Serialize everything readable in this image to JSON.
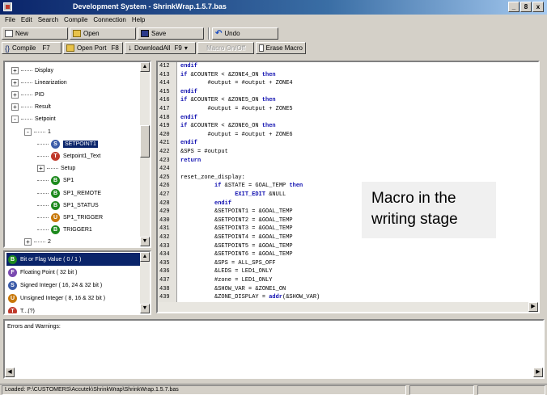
{
  "window": {
    "title": "Development System - ShrinkWrap.1.5.7.bas",
    "controls": [
      "_",
      "8",
      "x"
    ]
  },
  "menu": [
    "File",
    "Edit",
    "Search",
    "Compile",
    "Connection",
    "Help"
  ],
  "toolbar1": {
    "new_label": "New",
    "open_label": "Open",
    "save_label": "Save",
    "undo_label": "Undo"
  },
  "toolbar2": {
    "compile_label": "Compile",
    "compile_key": "F7",
    "open_port_label": "Open Port",
    "open_port_key": "F8",
    "download_label": "DownloadAll",
    "download_key": "F9",
    "macro_label": "Macro On/Off",
    "erase_label": "Erase Macro"
  },
  "tree": {
    "items": [
      {
        "label": "Display",
        "level": 0,
        "expander": "+"
      },
      {
        "label": "Linearization",
        "level": 0,
        "expander": "+"
      },
      {
        "label": "PID",
        "level": 0,
        "expander": "+"
      },
      {
        "label": "Result",
        "level": 0,
        "expander": "+"
      },
      {
        "label": "Setpoint",
        "level": 0,
        "expander": "-"
      },
      {
        "label": "1",
        "level": 1,
        "expander": "-"
      },
      {
        "label": "SETPOINT1",
        "level": 2,
        "icon": "S",
        "color": "blue",
        "selected": true
      },
      {
        "label": "Setpoint1_Text",
        "level": 2,
        "icon": "T",
        "color": "red"
      },
      {
        "label": "Setup",
        "level": 2,
        "expander": "+"
      },
      {
        "label": "SP1",
        "level": 2,
        "icon": "B",
        "color": "green"
      },
      {
        "label": "SP1_REMOTE",
        "level": 2,
        "icon": "B",
        "color": "green"
      },
      {
        "label": "SP1_STATUS",
        "level": 2,
        "icon": "B",
        "color": "green"
      },
      {
        "label": "SP1_TRIGGER",
        "level": 2,
        "icon": "U",
        "color": "orange"
      },
      {
        "label": "TRIGGER1",
        "level": 2,
        "icon": "B",
        "color": "green"
      },
      {
        "label": "2",
        "level": 1,
        "expander": "+"
      }
    ]
  },
  "types": {
    "items": [
      {
        "label": "Bit or Flag Value ( 0 / 1 )",
        "icon": "B",
        "color": "green",
        "selected": true
      },
      {
        "label": "Floating Point ( 32 bit )",
        "icon": "F",
        "color": "purple"
      },
      {
        "label": "Signed Integer ( 16, 24 & 32 bit )",
        "icon": "S",
        "color": "blue"
      },
      {
        "label": "Unsigned Integer ( 8, 16 & 32 bit )",
        "icon": "U",
        "color": "orange"
      },
      {
        "label": "T...(?)",
        "icon": "T",
        "color": "red"
      }
    ]
  },
  "code": {
    "lines": [
      {
        "n": "412",
        "t": "endif"
      },
      {
        "n": "413",
        "t": "if &COUNTER < &ZONE4_ON then"
      },
      {
        "n": "414",
        "t": "        #output = #output + ZONE4"
      },
      {
        "n": "415",
        "t": "endif"
      },
      {
        "n": "416",
        "t": "if &COUNTER < &ZONE5_ON then"
      },
      {
        "n": "417",
        "t": "        #output = #output + ZONE5"
      },
      {
        "n": "418",
        "t": "endif"
      },
      {
        "n": "419",
        "t": "if &COUNTER < &ZONE6_ON then"
      },
      {
        "n": "420",
        "t": "        #output = #output + ZONE6"
      },
      {
        "n": "421",
        "t": "endif"
      },
      {
        "n": "422",
        "t": "&SPS = #output"
      },
      {
        "n": "423",
        "t": "return"
      },
      {
        "n": "424",
        "t": ""
      },
      {
        "n": "425",
        "t": "reset_zone_display:"
      },
      {
        "n": "426",
        "t": "          if &STATE = GOAL_TEMP then"
      },
      {
        "n": "427",
        "t": "                EXIT_EDIT &NULL"
      },
      {
        "n": "428",
        "t": "          endif"
      },
      {
        "n": "429",
        "t": "          &SETPOINT1 = &GOAL_TEMP"
      },
      {
        "n": "430",
        "t": "          &SETPOINT2 = &GOAL_TEMP"
      },
      {
        "n": "431",
        "t": "          &SETPOINT3 = &GOAL_TEMP"
      },
      {
        "n": "432",
        "t": "          &SETPOINT4 = &GOAL_TEMP"
      },
      {
        "n": "433",
        "t": "          &SETPOINT5 = &GOAL_TEMP"
      },
      {
        "n": "434",
        "t": "          &SETPOINT6 = &GOAL_TEMP"
      },
      {
        "n": "435",
        "t": "          &SPS = ALL_SPS_OFF"
      },
      {
        "n": "436",
        "t": "          &LEDS = LED1_ONLY"
      },
      {
        "n": "437",
        "t": "          #zone = LED1_ONLY"
      },
      {
        "n": "438",
        "t": "          &SHOW_VAR = &ZONE1_ON"
      },
      {
        "n": "439",
        "t": "          &ZONE_DISPLAY = addr(&SHOW_VAR)"
      }
    ],
    "keywords": [
      "endif",
      "if",
      "then",
      "return",
      "EXIT_EDIT",
      "addr"
    ]
  },
  "callout": "Macro in the writing stage",
  "errors": {
    "label": "Errors and Warnings:"
  },
  "status": {
    "path": "Loaded: P:\\CUSTOMERS\\Accutek\\ShrinkWrap\\ShrinkWrap.1.5.7.bas"
  }
}
